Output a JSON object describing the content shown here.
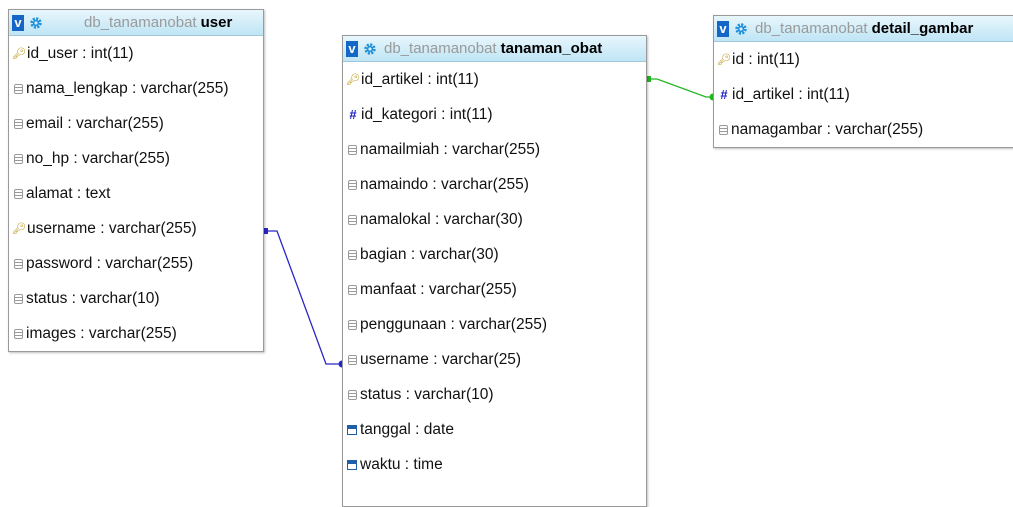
{
  "colors": {
    "fk_link_user": "#2a26c7",
    "fk_link_gambar": "#22b522",
    "header_bg": "#c9ebf8",
    "type_letter": "#1467c7"
  },
  "tables": {
    "user": {
      "toggle": "v",
      "db": "db_tanamanobat",
      "name": "user",
      "columns": [
        {
          "icon": "primary-key-icon",
          "text": "id_user : int(11)"
        },
        {
          "icon": "column-icon",
          "text": "nama_lengkap : varchar(255)"
        },
        {
          "icon": "column-icon",
          "text": "email : varchar(255)"
        },
        {
          "icon": "column-icon",
          "text": "no_hp : varchar(255)"
        },
        {
          "icon": "column-icon",
          "text": "alamat : text"
        },
        {
          "icon": "primary-key-icon",
          "text": "username : varchar(255)"
        },
        {
          "icon": "column-icon",
          "text": "password : varchar(255)"
        },
        {
          "icon": "column-icon",
          "text": "status : varchar(10)"
        },
        {
          "icon": "column-icon",
          "text": "images : varchar(255)"
        }
      ]
    },
    "tanaman_obat": {
      "toggle": "v",
      "db": "db_tanamanobat",
      "name": "tanaman_obat",
      "columns": [
        {
          "icon": "primary-key-icon",
          "text": "id_artikel : int(11)"
        },
        {
          "icon": "foreign-key-icon",
          "text": "id_kategori : int(11)"
        },
        {
          "icon": "column-icon",
          "text": "namailmiah : varchar(255)"
        },
        {
          "icon": "column-icon",
          "text": "namaindo : varchar(255)"
        },
        {
          "icon": "column-icon",
          "text": "namalokal : varchar(30)"
        },
        {
          "icon": "column-icon",
          "text": "bagian : varchar(30)"
        },
        {
          "icon": "column-icon",
          "text": "manfaat : varchar(255)"
        },
        {
          "icon": "column-icon",
          "text": "penggunaan : varchar(255)"
        },
        {
          "icon": "column-icon",
          "text": "username : varchar(25)"
        },
        {
          "icon": "column-icon",
          "text": "status : varchar(10)"
        },
        {
          "icon": "date-icon",
          "text": "tanggal : date"
        },
        {
          "icon": "date-icon",
          "text": "waktu : time"
        }
      ]
    },
    "detail_gambar": {
      "toggle": "v",
      "db": "db_tanamanobat",
      "name": "detail_gambar",
      "columns": [
        {
          "icon": "primary-key-icon",
          "text": "id : int(11)"
        },
        {
          "icon": "foreign-key-icon",
          "text": "id_artikel : int(11)"
        },
        {
          "icon": "column-icon",
          "text": "namagambar : varchar(255)"
        }
      ]
    }
  }
}
